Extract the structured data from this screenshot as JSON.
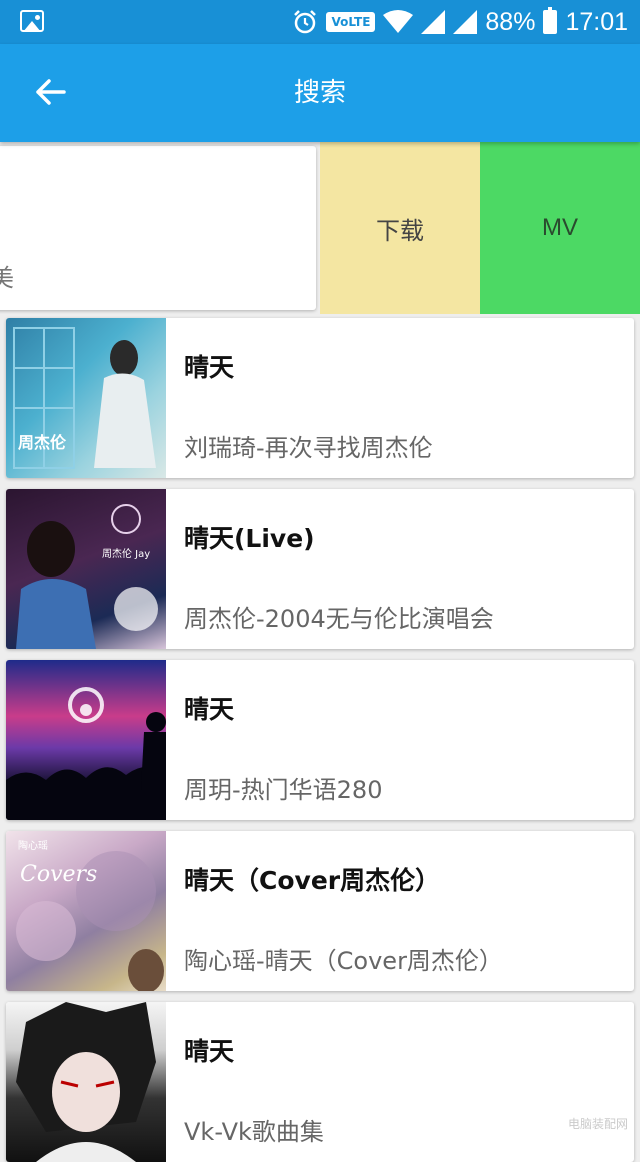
{
  "status_bar": {
    "volte": "VoLTE",
    "battery": "88%",
    "time": "17:01"
  },
  "app_bar": {
    "title": "搜索"
  },
  "swiped_item": {
    "subtitle_fragment": "美",
    "download_label": "下载",
    "mv_label": "MV"
  },
  "songs": [
    {
      "title": "晴天",
      "subtitle": "刘瑞琦-再次寻找周杰伦"
    },
    {
      "title": "晴天(Live)",
      "subtitle": "周杰伦-2004无与伦比演唱会"
    },
    {
      "title": "晴天",
      "subtitle": "周玥-热门华语280"
    },
    {
      "title": "晴天（Cover周杰伦）",
      "subtitle": "陶心瑶-晴天（Cover周杰伦）"
    },
    {
      "title": "晴天",
      "subtitle": "Vk-Vk歌曲集"
    }
  ],
  "covers": [
    {
      "text": "周杰伦"
    },
    {
      "text": "周杰伦 Jay"
    },
    {
      "text": ""
    },
    {
      "text": "Covers",
      "label": "陶心瑶"
    },
    {
      "text": ""
    }
  ],
  "watermark": "电脑装配网"
}
